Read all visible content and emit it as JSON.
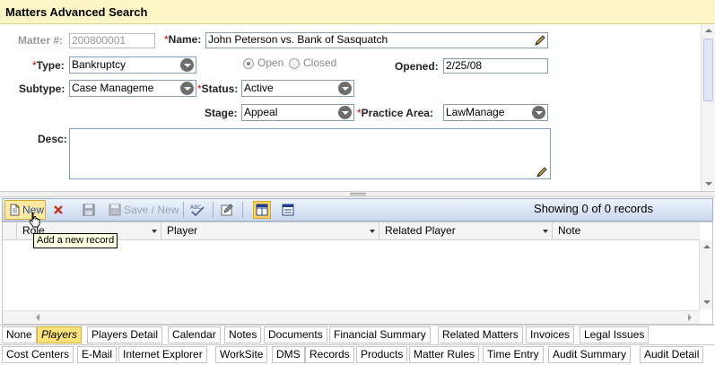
{
  "window": {
    "title": "Matters Advanced Search"
  },
  "form": {
    "matter_number": {
      "label": "Matter #:",
      "value": "200800001"
    },
    "name": {
      "label": "Name:",
      "required_mark": "*",
      "value": "John Peterson vs. Bank of Sasquatch"
    },
    "type": {
      "label": "Type:",
      "required_mark": "*",
      "value": "Bankruptcy"
    },
    "open_closed": {
      "open_label": "Open",
      "closed_label": "Closed",
      "selected": "Open"
    },
    "opened": {
      "label": "Opened:",
      "value": "2/25/08"
    },
    "subtype": {
      "label": "Subtype:",
      "value": "Case Manageme"
    },
    "status": {
      "label": "Status:",
      "required_mark": "*",
      "value": "Active"
    },
    "stage": {
      "label": "Stage:",
      "value": "Appeal"
    },
    "practice_area": {
      "label": "Practice Area:",
      "required_mark": "*",
      "value": "LawManage"
    },
    "desc": {
      "label": "Desc:",
      "value": ""
    }
  },
  "toolbar": {
    "new_label": "New",
    "save_new_label": "Save / New",
    "showing_text": "Showing 0 of 0 records",
    "tooltip": "Add a new record"
  },
  "grid": {
    "columns": [
      "Role",
      "Player",
      "Related Player",
      "Note"
    ]
  },
  "tabs": {
    "row1": [
      "None",
      "Players",
      "Players Detail",
      "Calendar",
      "Notes",
      "Documents",
      "Financial Summary",
      "Related Matters",
      "Invoices",
      "Legal Issues"
    ],
    "row2": [
      "Cost Centers",
      "E-Mail",
      "Internet Explorer",
      "WorkSite",
      "DMS",
      "Records",
      "Products",
      "Matter Rules",
      "Time Entry",
      "Audit Summary",
      "Audit Detail"
    ],
    "active": "Players"
  },
  "colors": {
    "title_bg": "#fcf6c6",
    "required": "#cc0000",
    "active_tab": "#fde27a"
  }
}
